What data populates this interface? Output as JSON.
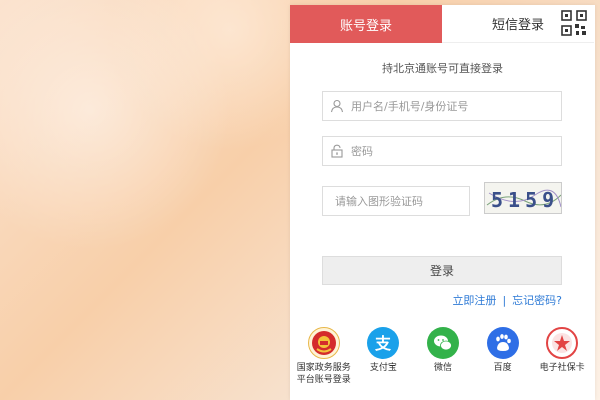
{
  "tabs": {
    "account_login": "账号登录",
    "sms_login": "短信登录"
  },
  "subtitle": "持北京通账号可直接登录",
  "form": {
    "username_placeholder": "用户名/手机号/身份证号",
    "password_placeholder": "密码",
    "captcha_placeholder": "请输入图形验证码",
    "captcha_text": "5159",
    "login_label": "登录"
  },
  "links": {
    "register": "立即注册",
    "separator": "|",
    "forgot": "忘记密码?"
  },
  "providers": [
    {
      "line1": "国家政务服务",
      "line2": "平台账号登录",
      "color": "#c8262a",
      "icon": "national-emblem-icon"
    },
    {
      "line1": "支付宝",
      "line2": "",
      "color": "#1aa1ea",
      "icon": "alipay-icon"
    },
    {
      "line1": "微信",
      "line2": "",
      "color": "#33b24a",
      "icon": "wechat-icon"
    },
    {
      "line1": "百度",
      "line2": "",
      "color": "#2e6ee6",
      "icon": "baidu-icon"
    },
    {
      "line1": "电子社保卡",
      "line2": "",
      "color": "#e24444",
      "icon": "social-security-card-icon"
    }
  ],
  "colors": {
    "accent": "#e15a5a",
    "link": "#2f7bd6"
  }
}
